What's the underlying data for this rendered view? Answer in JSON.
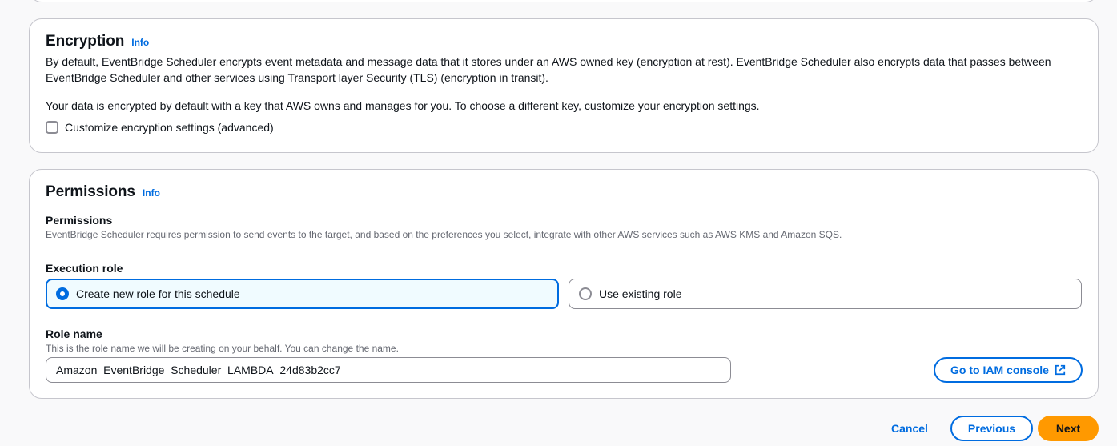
{
  "encryption": {
    "title": "Encryption",
    "info_label": "Info",
    "description": "By default, EventBridge Scheduler encrypts event metadata and message data that it stores under an AWS owned key (encryption at rest). EventBridge Scheduler also encrypts data that passes between EventBridge Scheduler and other services using Transport layer Security (TLS) (encryption in transit).",
    "default_key_text": "Your data is encrypted by default with a key that AWS owns and manages for you. To choose a different key, customize your encryption settings.",
    "customize_checkbox_label": "Customize encryption settings (advanced)",
    "customize_checked": false
  },
  "permissions": {
    "title": "Permissions",
    "info_label": "Info",
    "section_label": "Permissions",
    "section_description": "EventBridge Scheduler requires permission to send events to the target, and based on the preferences you select, integrate with other AWS services such as AWS KMS and Amazon SQS.",
    "execution_role_label": "Execution role",
    "role_options": [
      {
        "label": "Create new role for this schedule",
        "selected": true
      },
      {
        "label": "Use existing role",
        "selected": false
      }
    ],
    "role_name_label": "Role name",
    "role_name_description": "This is the role name we will be creating on your behalf. You can change the name.",
    "role_name_value": "Amazon_EventBridge_Scheduler_LAMBDA_24d83b2cc7",
    "iam_console_button": "Go to IAM console",
    "iam_console_icon": "external-link-icon"
  },
  "footer": {
    "cancel_label": "Cancel",
    "previous_label": "Previous",
    "next_label": "Next"
  },
  "colors": {
    "link_blue": "#006ce0",
    "primary_orange": "#ff9900",
    "selected_tile_bg": "#f0fbff",
    "border_gray": "#c6c6cd"
  }
}
